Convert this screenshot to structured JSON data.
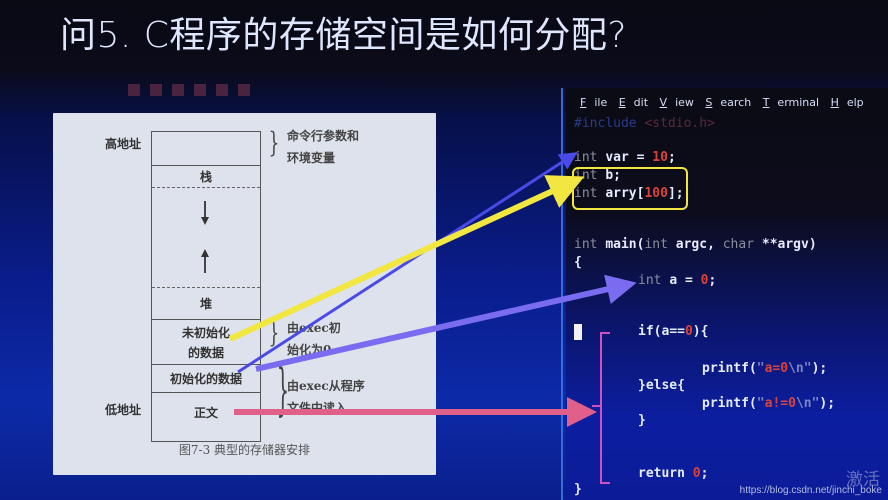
{
  "slide": {
    "title": "问5. C程序的存储空间是如何分配?"
  },
  "figure": {
    "high_address_label": "高地址",
    "low_address_label": "低地址",
    "segments": [
      {
        "id": "args-env",
        "label": ""
      },
      {
        "id": "stack",
        "label": "栈"
      },
      {
        "id": "gap",
        "label": ""
      },
      {
        "id": "heap",
        "label": "堆"
      },
      {
        "id": "bss",
        "label": "未初始化\n的数据"
      },
      {
        "id": "data",
        "label": "初始化的数据"
      },
      {
        "id": "text",
        "label": "正文"
      }
    ],
    "brace_notes": [
      "命令行参数和\n环境变量",
      "由exec初\n始化为0",
      "由exec从程序\n文件中读入"
    ],
    "caption": "图7-3  典型的存储器安排"
  },
  "terminal": {
    "menu": [
      {
        "label": "File",
        "mnemonic": "F"
      },
      {
        "label": "Edit",
        "mnemonic": "E"
      },
      {
        "label": "View",
        "mnemonic": "V"
      },
      {
        "label": "Search",
        "mnemonic": "S"
      },
      {
        "label": "Terminal",
        "mnemonic": "T"
      },
      {
        "label": "Help",
        "mnemonic": "H"
      }
    ],
    "code": {
      "include": "#include <stdio.h>",
      "line_var": "int var = 10;",
      "line_b": "int b;",
      "line_arry": "int arry[100];",
      "line_main": "int main(int argc, char **argv)",
      "line_open": "{",
      "line_a": "int a = 0;",
      "line_if": "if(a==0){",
      "line_printf1": "printf(\"a=0\\n\");",
      "line_else": "}else{",
      "line_printf2": "printf(\"a!=0\\n\");",
      "line_close_if": "}",
      "line_return": "return 0;",
      "line_close": "}"
    }
  },
  "annotations": {
    "arrows": [
      {
        "from": "bss",
        "to": "int b; int arry[100];",
        "color": "#f2e640"
      },
      {
        "from": "data",
        "to": "int var = 10;",
        "color": "#4a4ae8"
      },
      {
        "from": "data",
        "to": "int a = 0;",
        "color": "#7a6cf0"
      },
      {
        "from": "text",
        "to": "main body",
        "color": "#e0608a"
      }
    ],
    "highlight_box_color": "#f2e640",
    "bracket_color": "#d050c0"
  },
  "watermark": {
    "url": "https://blog.csdn.net/jinchi_boke",
    "activate": "激活"
  }
}
